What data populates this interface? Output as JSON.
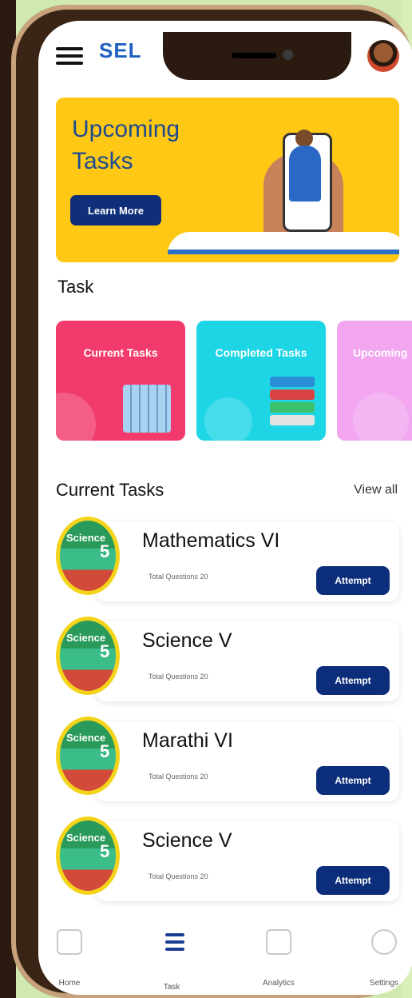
{
  "app": {
    "logo_text": "SEL",
    "banner": {
      "title": "Upcoming Tasks",
      "button_label": "Learn More"
    },
    "section_title": "Task",
    "task_cards": [
      {
        "label": "Current Tasks",
        "color": "#f23b6c"
      },
      {
        "label": "Completed Tasks",
        "color": "#1ed5e6"
      },
      {
        "label": "Upcoming",
        "color": "#f2a6f0"
      }
    ],
    "current_tasks_title": "Current Tasks",
    "view_all_label": "View all",
    "tasks": [
      {
        "name": "Mathematics VI",
        "meta": "Total Questions 20",
        "button": "Attempt",
        "cover_text": "Science",
        "cover_num": "5"
      },
      {
        "name": "Science V",
        "meta": "Total Questions 20",
        "button": "Attempt",
        "cover_text": "Science",
        "cover_num": "5"
      },
      {
        "name": "Marathi VI",
        "meta": "Total Questions 20",
        "button": "Attempt",
        "cover_text": "Science",
        "cover_num": "5"
      },
      {
        "name": "Science V",
        "meta": "Total Questions 20",
        "button": "Attempt",
        "cover_text": "Science",
        "cover_num": "5"
      }
    ],
    "nav": [
      {
        "label": "Home",
        "icon": "home-icon"
      },
      {
        "label": "Task",
        "icon": "task-list-icon"
      },
      {
        "label": "Analytics",
        "icon": "analytics-icon"
      },
      {
        "label": "Settings",
        "icon": "gear-icon"
      }
    ]
  }
}
